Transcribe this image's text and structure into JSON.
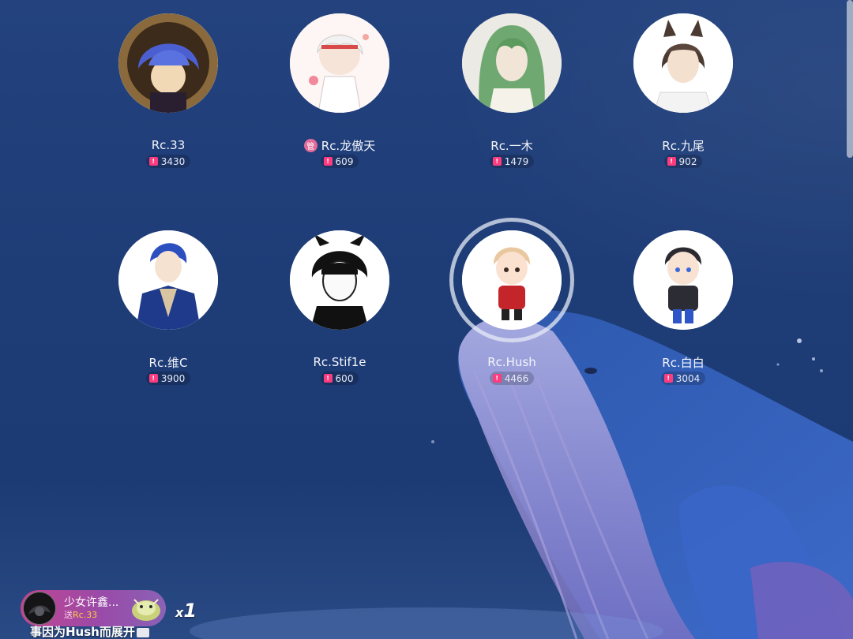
{
  "seats": [
    {
      "name": "Rc.33",
      "score": "3430",
      "badge": "",
      "speaking": false
    },
    {
      "name": "Rc.龙傲天",
      "score": "609",
      "badge": "管",
      "speaking": false
    },
    {
      "name": "Rc.一木",
      "score": "1479",
      "badge": "",
      "speaking": false
    },
    {
      "name": "Rc.九尾",
      "score": "902",
      "badge": "",
      "speaking": false
    },
    {
      "name": "Rc.维C",
      "score": "3900",
      "badge": "",
      "speaking": false
    },
    {
      "name": "Rc.Stif1e",
      "score": "600",
      "badge": "",
      "speaking": false
    },
    {
      "name": "Rc.Hush",
      "score": "4466",
      "badge": "",
      "speaking": true
    },
    {
      "name": "Rc.白白",
      "score": "3004",
      "badge": "",
      "speaking": false
    }
  ],
  "gift_banner": {
    "sender": "少女许鑫...",
    "prefix": "送",
    "target": "Rc.33",
    "count_prefix": "x",
    "count": "1"
  },
  "ticker": "事因为Hush而展开",
  "colors": {
    "background": "#1f3d78",
    "score_icon": "#ff3b7f",
    "banner_start": "#c14590",
    "banner_end": "#8a62b6"
  }
}
